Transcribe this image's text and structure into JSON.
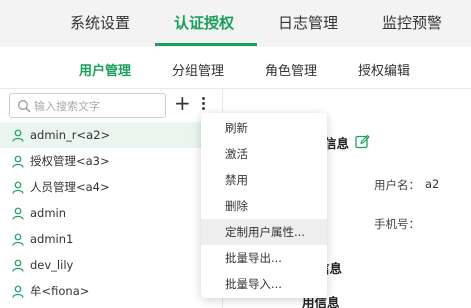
{
  "top_tabs": [
    "系统设置",
    "认证授权",
    "日志管理",
    "监控预警"
  ],
  "active_top_tab": "认证授权",
  "sub_tabs": [
    "用户管理",
    "分组管理",
    "角色管理",
    "授权编辑"
  ],
  "active_sub_tab": "用户管理",
  "search": {
    "placeholder": "输入搜索文字",
    "value": ""
  },
  "toolbar": {
    "add_label": "+",
    "more_icon": "more-vertical-icon"
  },
  "users": [
    "admin_r<a2>",
    "授权管理<a3>",
    "人员管理<a4>",
    "admin",
    "admin1",
    "dev_lily",
    "牟<fiona>"
  ],
  "selected_user_index": 0,
  "context_menu": {
    "items": [
      "刷新",
      "激活",
      "禁用",
      "删除",
      "定制用户属性...",
      "批量导出...",
      "批量导入..."
    ],
    "hovered_index": 4
  },
  "detail": {
    "basic_title_partial": "信息",
    "username_label": "用户名：",
    "username_value": "a2",
    "phone_label": "手机号：",
    "phone_value": "",
    "section2_title_partial": "信息",
    "section3_title_partial": "用信息"
  },
  "colors": {
    "accent": "#1aa05c",
    "selected_row": "#e9f5ee",
    "menu_hover": "#eeeeee"
  }
}
